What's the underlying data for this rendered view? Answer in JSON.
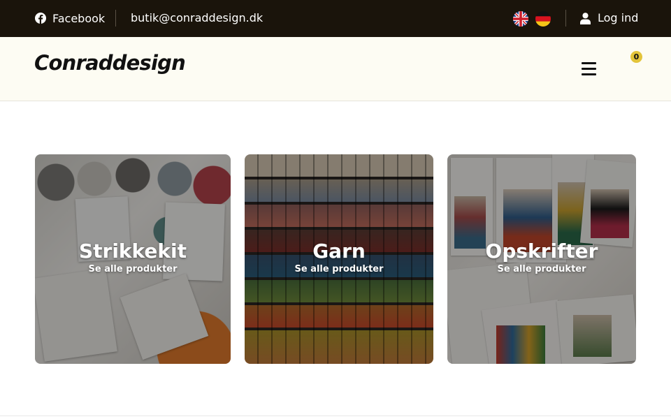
{
  "topbar": {
    "facebook_label": "Facebook",
    "email": "butik@conraddesign.dk",
    "languages": [
      "English",
      "Deutsch"
    ],
    "login_label": "Log ind"
  },
  "header": {
    "logo_text": "Conraddesign",
    "cart_count": "0"
  },
  "categories": [
    {
      "title": "Strikkekit",
      "subtitle": "Se alle produkter"
    },
    {
      "title": "Garn",
      "subtitle": "Se alle produkter"
    },
    {
      "title": "Opskrifter",
      "subtitle": "Se alle produkter"
    }
  ],
  "colors": {
    "topbar_bg": "#1a140b",
    "header_bg": "#fdfcf3",
    "badge": "#e3c43a"
  },
  "icons": [
    "facebook-icon",
    "uk-flag-icon",
    "german-flag-icon",
    "user-icon",
    "menu-icon"
  ]
}
